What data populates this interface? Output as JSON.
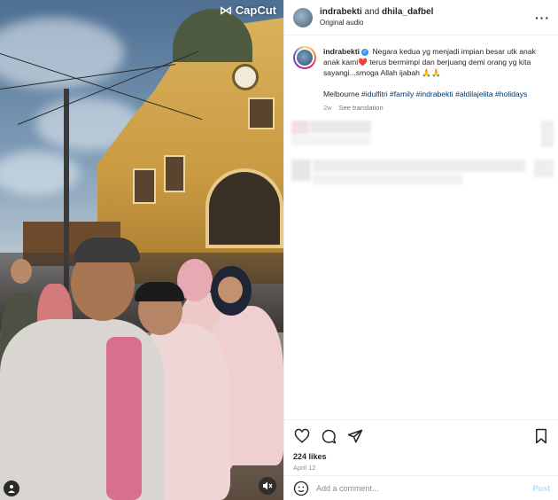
{
  "media": {
    "watermark": "CapCut",
    "user_tag_icon": "person-icon",
    "mute_icon": "speaker-muted-icon"
  },
  "header": {
    "author": "indrabekti",
    "conjunction": "and",
    "collaborator": "dhila_dafbel",
    "audio": "Original audio",
    "more_icon": "more-horizontal-icon"
  },
  "caption": {
    "username": "indrabekti",
    "text_part1": "Negara kedua yg menjadi impian besar utk anak anak kami",
    "heart": "❤️",
    "text_part2": " terus bermimpi dan berjuang demi orang yg kita sayangi...smoga Allah ijabah 🙏🙏",
    "location": "Melbourne",
    "hashtags": [
      "#idulfitri",
      "#family",
      "#indrabekti",
      "#aldilajelita",
      "#holidays"
    ],
    "time_ago": "2w",
    "see_translation": "See translation"
  },
  "actions": {
    "like_icon": "heart-icon",
    "comment_icon": "comment-icon",
    "share_icon": "send-icon",
    "save_icon": "bookmark-icon",
    "likes": "224 likes",
    "date": "April 12"
  },
  "comment_bar": {
    "emoji_icon": "emoji-icon",
    "placeholder": "Add a comment...",
    "post_label": "Post"
  },
  "colors": {
    "link": "#00376b",
    "verified": "#3897f0",
    "muted_text": "#8e8e8e",
    "post_disabled": "#b2dffc"
  }
}
